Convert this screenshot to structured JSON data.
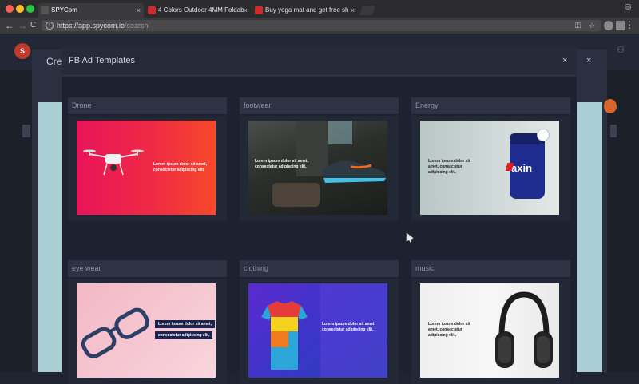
{
  "browser": {
    "tabs": [
      {
        "title": "SPYCom",
        "favicon_color": "#3a3a3c",
        "active": true
      },
      {
        "title": "4 Colors Outdoor 4MM Foldab",
        "favicon_color": "#d22a2a",
        "active": false
      },
      {
        "title": "Buy yoga mat and get free sh",
        "favicon_color": "#d22a2a",
        "active": false
      }
    ],
    "tab_close_glyph": "×",
    "nav": {
      "back": "←",
      "forward": "→",
      "reload": "C"
    },
    "url_host": "https://app.spycom.io",
    "url_path": "/search",
    "info_glyph": "i",
    "key_glyph": "⚿",
    "star_glyph": "☆",
    "menu_glyph": "⋮"
  },
  "background": {
    "outer_title": "Crea",
    "outer_close": "×"
  },
  "modal": {
    "title": "FB Ad Templates",
    "close": "×",
    "templates": [
      {
        "label": "Drone",
        "ad_text": "Lorem ipsum dolor sit amet, consectetur adipiscing elit,"
      },
      {
        "label": "footwear",
        "ad_text": "Lorem ipsum dolor sit amet, consectetur adipiscing elit,"
      },
      {
        "label": "Energy",
        "ad_text": "Lorem ipsum dolor sit amet, consectetur adipiscing elit,",
        "product_text": "axin"
      },
      {
        "label": "eye wear",
        "ad_text_line1": "Lorem ipsum dolor sit amet,",
        "ad_text_line2": "consectetur adipiscing elit,"
      },
      {
        "label": "clothing",
        "ad_text": "Lorem ipsum dolor sit amet, consectetur adipiscing elit,"
      },
      {
        "label": "music",
        "ad_text": "Lorem ipsum dolor sit amet, consectetur adipiscing elit,"
      }
    ]
  },
  "colors": {
    "modal_bg": "#262b3a",
    "accent_red": "#e8145a"
  }
}
